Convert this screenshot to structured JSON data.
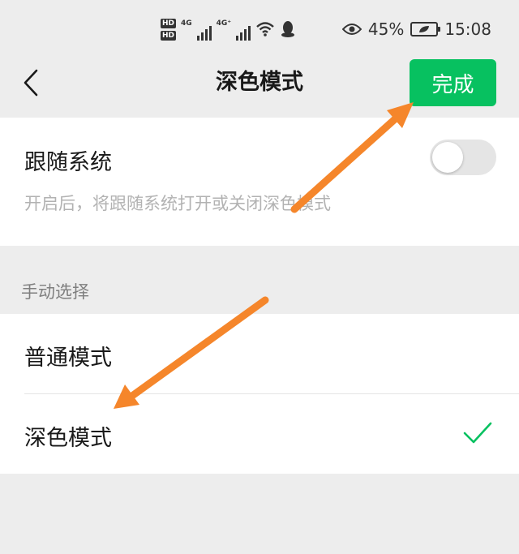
{
  "status_bar": {
    "hd1": "HD",
    "hd2": "HD",
    "net1": "4G",
    "net2": "4G⁺",
    "battery_percent": "45%",
    "time": "15:08",
    "icons": [
      "signal-icon",
      "wifi-icon",
      "qq-icon",
      "eye-icon",
      "battery-icon"
    ]
  },
  "nav": {
    "title": "深色模式",
    "done_label": "完成",
    "back_icon": "chevron-left-icon"
  },
  "follow_system": {
    "label": "跟随系统",
    "description": "开启后，将跟随系统打开或关闭深色模式",
    "enabled": false
  },
  "manual": {
    "header": "手动选择",
    "options": [
      {
        "label": "普通模式",
        "selected": false
      },
      {
        "label": "深色模式",
        "selected": true
      }
    ]
  },
  "colors": {
    "accent": "#07c160",
    "annotation_arrow": "#f5862b",
    "background": "#ededed"
  }
}
